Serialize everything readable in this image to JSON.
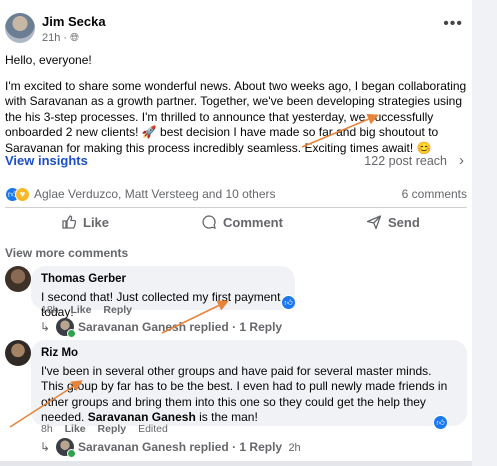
{
  "post": {
    "author": "Jim Secka",
    "time": "21h",
    "privacy_icon": "globe-icon",
    "greeting": "Hello, everyone!",
    "body": "I'm excited to share some wonderful news. About two weeks ago, I began collaborating with Saravanan as a growth partner. Together, we've been developing strategies using the his 3-step processes. I'm thrilled to announce that yesterday, we successfully onboarded 2 new clients! 🚀 best decision I have made so far and big shoutout to Saravanan for making this process incredibly seamless. Exciting times await! 😊",
    "view_insights": "View insights",
    "post_reach": "122 post reach",
    "reactors": "Aglae Verduzco, Matt Versteeg and 10 others",
    "comments_count": "6 comments",
    "actions": {
      "like": "Like",
      "comment": "Comment",
      "send": "Send"
    }
  },
  "view_more_comments": "View more comments",
  "comments": [
    {
      "author": "Thomas Gerber",
      "text": "I second that! Just collected my first payment today!",
      "time": "18h",
      "like": "Like",
      "reply": "Reply",
      "reply_summary": "Saravanan Ganesh replied · 1 Reply"
    },
    {
      "author": "Riz Mo",
      "text_before": "I've been in several other groups and have paid for several master minds. This group by far has to be the best. I even had to pull newly made friends in other groups and bring them into this one so they could get the help they needed. ",
      "text_bold": "Saravanan Ganesh",
      "text_after": " is the man!",
      "time": "8h",
      "like": "Like",
      "reply": "Reply",
      "edited": "Edited",
      "reply_summary": "Saravanan Ganesh replied · 1 Reply",
      "reply_time": "2h"
    }
  ],
  "colors": {
    "link": "#1b4fc4",
    "accent": "#1877f2",
    "annotation_arrow": "#e8843a"
  }
}
